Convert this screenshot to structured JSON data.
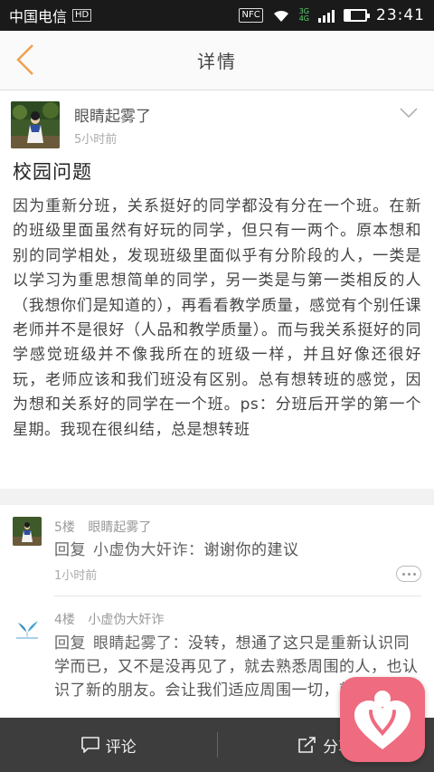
{
  "status_bar": {
    "carrier": "中国电信",
    "hd_badge": "HD",
    "nfc": "NFC",
    "net_top": "3G",
    "net_bottom": "4G",
    "time": "23:41"
  },
  "nav": {
    "title": "详情",
    "back_icon": "chevron-left-icon"
  },
  "post": {
    "author": "眼睛起雾了",
    "time": "5小时前",
    "title": "校园问题",
    "body": "因为重新分班，关系挺好的同学都没有分在一个班。在新的班级里面虽然有好玩的同学，但只有一两个。原本想和别的同学相处，发现班级里面似乎有分阶段的人，一类是以学习为重思想简单的同学，另一类是与第一类相反的人（我想你们是知道的），再看看教学质量，感觉有个别任课老师并不是很好（人品和教学质量）。而与我关系挺好的同学感觉班级并不像我所在的班级一样，并且好像还很好玩，老师应该和我们班没有区别。总有想转班的感觉，因为想和关系好的同学在一个班。ps：分班后开学的第一个星期。我现在很纠结，总是想转班",
    "collapse_icon": "chevron-down-icon"
  },
  "comments": [
    {
      "floor": "5楼",
      "author": "眼睛起雾了",
      "reply_label": "回复",
      "reply_to": "小虚伪大奸诈：",
      "text": "谢谢你的建议",
      "time": "1小时前"
    },
    {
      "floor": "4楼",
      "author": "小虚伪大奸诈",
      "reply_label": "回复",
      "reply_to": "眼睛起雾了：",
      "text": "没转，想通了这只是重新认识同学而已，又不是没再见了，就去熟悉周围的人，也认识了新的朋友。会让我们适应周围一切，就当作是"
    }
  ],
  "bottom_bar": {
    "comment_label": "评论",
    "share_label": "分享"
  },
  "colors": {
    "accent_orange": "#f0a04b",
    "float_pink": "#ef6b7f",
    "bottom_bar": "#3d3d3d"
  }
}
